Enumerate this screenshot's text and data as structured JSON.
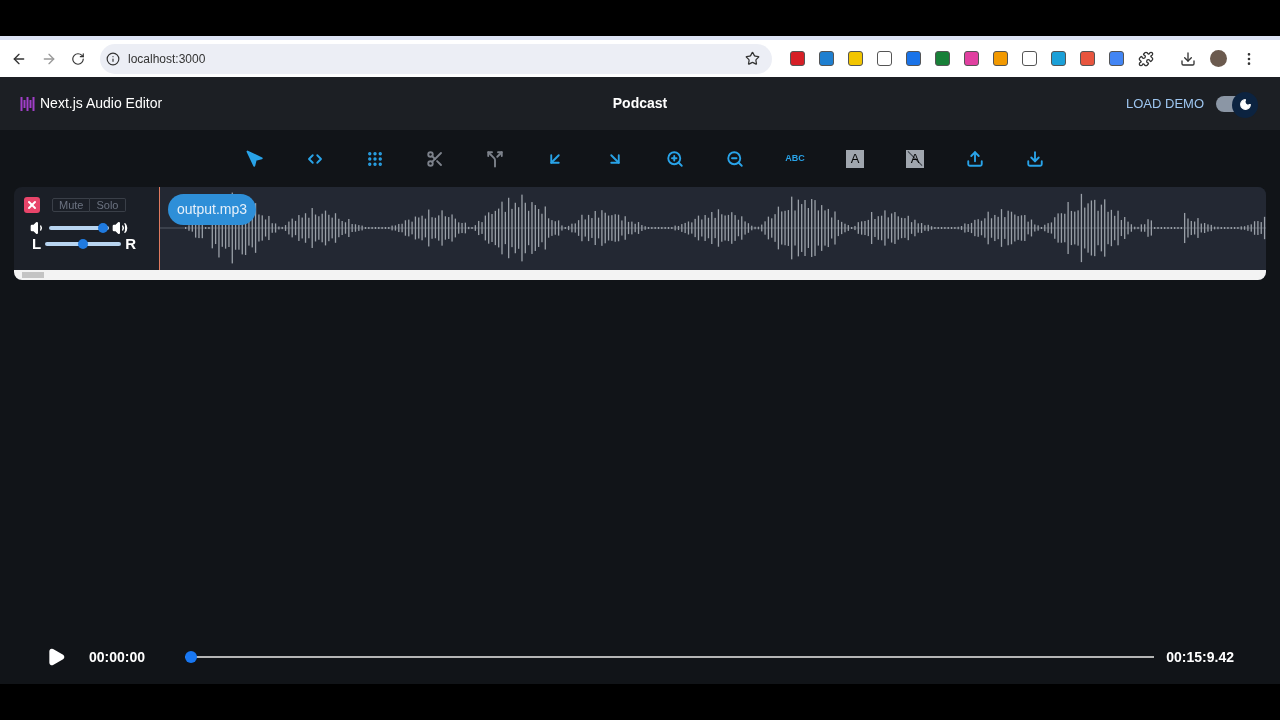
{
  "browser": {
    "url": "localhost:3000"
  },
  "header": {
    "title": "Next.js Audio Editor",
    "project": "Podcast",
    "load_demo": "LOAD DEMO",
    "dark_mode": true
  },
  "toolbar": [
    {
      "kind": "cursor",
      "disabled": false
    },
    {
      "kind": "shift",
      "disabled": false
    },
    {
      "kind": "select",
      "disabled": false
    },
    {
      "kind": "cut",
      "disabled": true
    },
    {
      "kind": "split",
      "disabled": true
    },
    {
      "kind": "fade-in",
      "disabled": false
    },
    {
      "kind": "fade-out",
      "disabled": false
    },
    {
      "kind": "zoom-in",
      "disabled": false
    },
    {
      "kind": "zoom-out",
      "disabled": false
    },
    {
      "kind": "text",
      "label": "ABC",
      "disabled": false
    },
    {
      "kind": "caption",
      "label": "A",
      "disabled": true
    },
    {
      "kind": "no-caption",
      "label": "A",
      "disabled": true
    },
    {
      "kind": "upload",
      "disabled": false
    },
    {
      "kind": "download",
      "disabled": false
    }
  ],
  "track": {
    "mute": {
      "label": "Mute",
      "selected": false
    },
    "solo": {
      "label": "Solo",
      "selected": false
    },
    "volume": {
      "level": 0.9
    },
    "pan": {
      "left": "L",
      "right": "R",
      "level": 0.5
    },
    "clip": "output.mp3"
  },
  "player": {
    "time": "00:00:00",
    "position": {
      "level": 0
    },
    "duration": "00:15:9.42"
  }
}
